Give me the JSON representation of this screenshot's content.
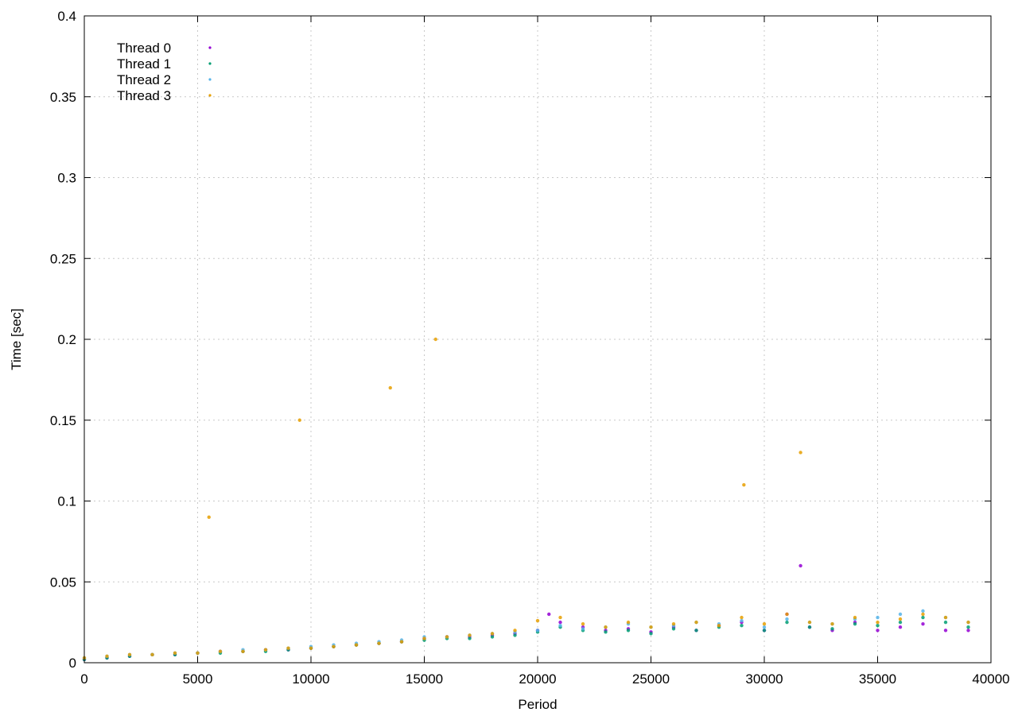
{
  "chart_data": {
    "type": "scatter",
    "xlabel": "Period",
    "ylabel": "Time [sec]",
    "xlim": [
      0,
      40000
    ],
    "ylim": [
      0,
      0.4
    ],
    "x_ticks": [
      "0",
      "5000",
      "10000",
      "15000",
      "20000",
      "25000",
      "30000",
      "35000",
      "40000"
    ],
    "y_ticks": [
      "0",
      "0.05",
      "0.1",
      "0.15",
      "0.2",
      "0.25",
      "0.3",
      "0.35",
      "0.4"
    ],
    "grid": true,
    "legend_position": "top-left",
    "series": [
      {
        "name": "Thread 0",
        "color": "#9400d3",
        "x": [
          0,
          1000,
          2000,
          3000,
          4000,
          5000,
          6000,
          7000,
          8000,
          9000,
          10000,
          11000,
          12000,
          13000,
          14000,
          15000,
          16000,
          17000,
          18000,
          19000,
          20000,
          20500,
          21000,
          22000,
          23000,
          24000,
          25000,
          26000,
          27000,
          28000,
          29000,
          30000,
          31000,
          31600,
          32000,
          33000,
          34000,
          35000,
          36000,
          37000,
          38000,
          39000
        ],
        "y": [
          0.002,
          0.003,
          0.004,
          0.005,
          0.005,
          0.006,
          0.007,
          0.007,
          0.008,
          0.008,
          0.009,
          0.01,
          0.011,
          0.012,
          0.013,
          0.015,
          0.016,
          0.016,
          0.017,
          0.018,
          0.02,
          0.03,
          0.025,
          0.022,
          0.02,
          0.021,
          0.019,
          0.022,
          0.02,
          0.023,
          0.025,
          0.02,
          0.03,
          0.06,
          0.022,
          0.02,
          0.025,
          0.02,
          0.022,
          0.024,
          0.02,
          0.02
        ]
      },
      {
        "name": "Thread 1",
        "color": "#009e73",
        "x": [
          0,
          1000,
          2000,
          3000,
          4000,
          5000,
          6000,
          7000,
          8000,
          9000,
          10000,
          11000,
          12000,
          13000,
          14000,
          15000,
          16000,
          17000,
          18000,
          19000,
          20000,
          21000,
          22000,
          23000,
          24000,
          25000,
          26000,
          27000,
          28000,
          29000,
          30000,
          31000,
          32000,
          33000,
          34000,
          35000,
          36000,
          37000,
          38000,
          39000
        ],
        "y": [
          0.002,
          0.003,
          0.004,
          0.005,
          0.005,
          0.006,
          0.006,
          0.007,
          0.007,
          0.008,
          0.009,
          0.01,
          0.011,
          0.012,
          0.013,
          0.014,
          0.015,
          0.015,
          0.016,
          0.017,
          0.019,
          0.022,
          0.02,
          0.019,
          0.02,
          0.018,
          0.021,
          0.02,
          0.022,
          0.023,
          0.02,
          0.025,
          0.022,
          0.021,
          0.024,
          0.023,
          0.025,
          0.028,
          0.025,
          0.022
        ]
      },
      {
        "name": "Thread 2",
        "color": "#56b4e9",
        "x": [
          0,
          1000,
          2000,
          3000,
          4000,
          5000,
          6000,
          7000,
          8000,
          9000,
          10000,
          11000,
          12000,
          13000,
          14000,
          15000,
          16000,
          17000,
          18000,
          19000,
          20000,
          21000,
          22000,
          23000,
          24000,
          25000,
          26000,
          27000,
          28000,
          29000,
          30000,
          31000,
          32000,
          33000,
          34000,
          35000,
          36000,
          37000,
          38000,
          39000
        ],
        "y": [
          0.003,
          0.004,
          0.005,
          0.005,
          0.006,
          0.006,
          0.007,
          0.008,
          0.008,
          0.009,
          0.01,
          0.011,
          0.012,
          0.013,
          0.014,
          0.016,
          0.016,
          0.017,
          0.018,
          0.019,
          0.02,
          0.023,
          0.021,
          0.022,
          0.024,
          0.022,
          0.023,
          0.025,
          0.024,
          0.026,
          0.022,
          0.027,
          0.025,
          0.024,
          0.027,
          0.028,
          0.03,
          0.032,
          0.028,
          0.025
        ]
      },
      {
        "name": "Thread 3",
        "color": "#e69f00",
        "x": [
          0,
          1000,
          2000,
          3000,
          4000,
          5000,
          5500,
          6000,
          7000,
          8000,
          9000,
          9500,
          10000,
          11000,
          12000,
          13000,
          13500,
          14000,
          15000,
          15500,
          16000,
          17000,
          18000,
          19000,
          20000,
          21000,
          22000,
          23000,
          24000,
          25000,
          26000,
          27000,
          28000,
          29000,
          29100,
          30000,
          31000,
          31600,
          32000,
          33000,
          34000,
          35000,
          36000,
          37000,
          38000,
          39000
        ],
        "y": [
          0.003,
          0.004,
          0.005,
          0.005,
          0.006,
          0.006,
          0.09,
          0.007,
          0.007,
          0.008,
          0.009,
          0.15,
          0.009,
          0.01,
          0.011,
          0.012,
          0.17,
          0.013,
          0.015,
          0.2,
          0.016,
          0.017,
          0.018,
          0.02,
          0.026,
          0.028,
          0.024,
          0.022,
          0.025,
          0.022,
          0.024,
          0.025,
          0.023,
          0.028,
          0.11,
          0.024,
          0.03,
          0.13,
          0.025,
          0.024,
          0.028,
          0.025,
          0.027,
          0.03,
          0.028,
          0.025
        ]
      }
    ]
  }
}
